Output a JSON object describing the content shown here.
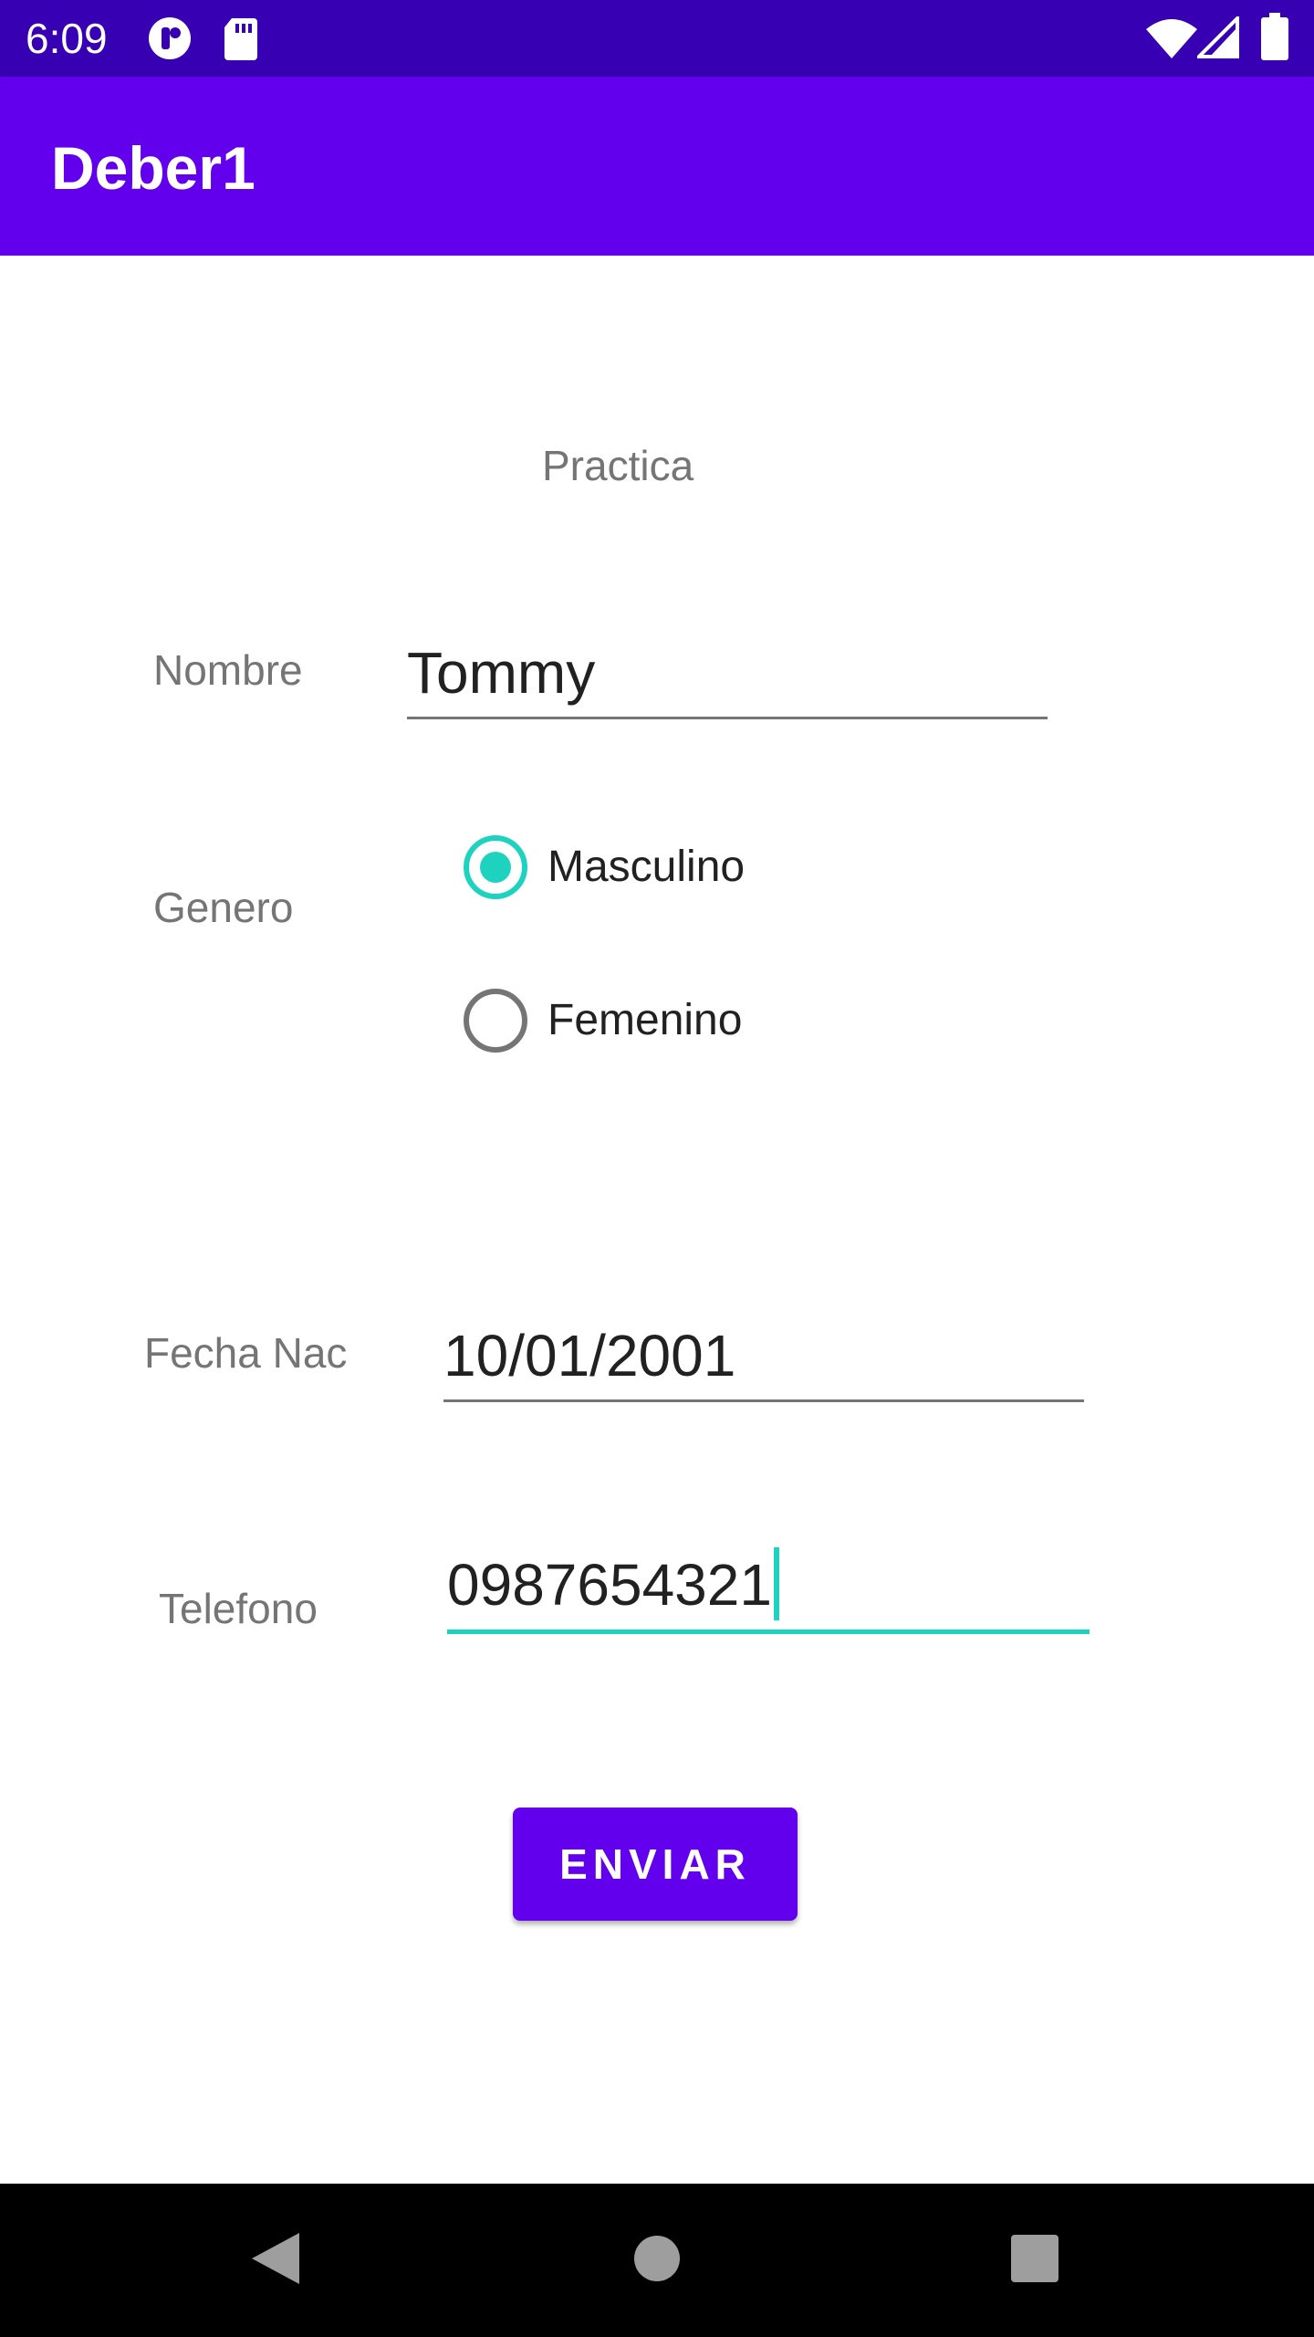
{
  "status_bar": {
    "time": "6:09",
    "icons": [
      "app-notification-icon",
      "sd-card-icon",
      "wifi-icon",
      "cell-signal-icon",
      "battery-icon"
    ],
    "background": "#3700b3"
  },
  "app_bar": {
    "title": "Deber1",
    "background": "#6200ee"
  },
  "form": {
    "header": "Practica",
    "nombre": {
      "label": "Nombre",
      "value": "Tommy"
    },
    "genero": {
      "label": "Genero",
      "options": [
        {
          "label": "Masculino",
          "checked": true
        },
        {
          "label": "Femenino",
          "checked": false
        }
      ]
    },
    "fecha_nac": {
      "label": "Fecha Nac",
      "value": "10/01/2001"
    },
    "telefono": {
      "label": "Telefono",
      "value": "0987654321",
      "focused": true
    },
    "submit_label": "ENVIAR"
  },
  "colors": {
    "primary": "#6200ee",
    "primary_dark": "#3700b3",
    "accent": "#1dd3c0",
    "label_gray": "#757575"
  },
  "nav_bar": {
    "buttons": [
      "back-icon",
      "home-icon",
      "recents-icon"
    ]
  }
}
